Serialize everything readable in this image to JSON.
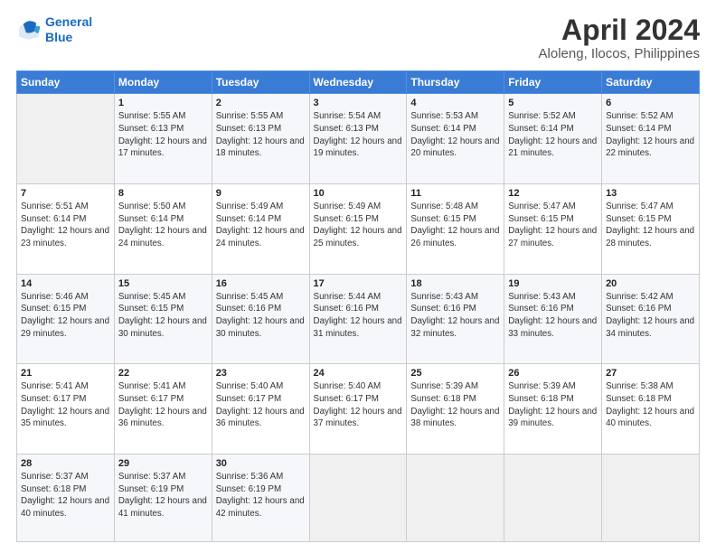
{
  "logo": {
    "line1": "General",
    "line2": "Blue"
  },
  "title": "April 2024",
  "subtitle": "Aloleng, Ilocos, Philippines",
  "days_header": [
    "Sunday",
    "Monday",
    "Tuesday",
    "Wednesday",
    "Thursday",
    "Friday",
    "Saturday"
  ],
  "weeks": [
    [
      {
        "num": "",
        "sunrise": "",
        "sunset": "",
        "daylight": ""
      },
      {
        "num": "1",
        "sunrise": "Sunrise: 5:55 AM",
        "sunset": "Sunset: 6:13 PM",
        "daylight": "Daylight: 12 hours and 17 minutes."
      },
      {
        "num": "2",
        "sunrise": "Sunrise: 5:55 AM",
        "sunset": "Sunset: 6:13 PM",
        "daylight": "Daylight: 12 hours and 18 minutes."
      },
      {
        "num": "3",
        "sunrise": "Sunrise: 5:54 AM",
        "sunset": "Sunset: 6:13 PM",
        "daylight": "Daylight: 12 hours and 19 minutes."
      },
      {
        "num": "4",
        "sunrise": "Sunrise: 5:53 AM",
        "sunset": "Sunset: 6:14 PM",
        "daylight": "Daylight: 12 hours and 20 minutes."
      },
      {
        "num": "5",
        "sunrise": "Sunrise: 5:52 AM",
        "sunset": "Sunset: 6:14 PM",
        "daylight": "Daylight: 12 hours and 21 minutes."
      },
      {
        "num": "6",
        "sunrise": "Sunrise: 5:52 AM",
        "sunset": "Sunset: 6:14 PM",
        "daylight": "Daylight: 12 hours and 22 minutes."
      }
    ],
    [
      {
        "num": "7",
        "sunrise": "Sunrise: 5:51 AM",
        "sunset": "Sunset: 6:14 PM",
        "daylight": "Daylight: 12 hours and 23 minutes."
      },
      {
        "num": "8",
        "sunrise": "Sunrise: 5:50 AM",
        "sunset": "Sunset: 6:14 PM",
        "daylight": "Daylight: 12 hours and 24 minutes."
      },
      {
        "num": "9",
        "sunrise": "Sunrise: 5:49 AM",
        "sunset": "Sunset: 6:14 PM",
        "daylight": "Daylight: 12 hours and 24 minutes."
      },
      {
        "num": "10",
        "sunrise": "Sunrise: 5:49 AM",
        "sunset": "Sunset: 6:15 PM",
        "daylight": "Daylight: 12 hours and 25 minutes."
      },
      {
        "num": "11",
        "sunrise": "Sunrise: 5:48 AM",
        "sunset": "Sunset: 6:15 PM",
        "daylight": "Daylight: 12 hours and 26 minutes."
      },
      {
        "num": "12",
        "sunrise": "Sunrise: 5:47 AM",
        "sunset": "Sunset: 6:15 PM",
        "daylight": "Daylight: 12 hours and 27 minutes."
      },
      {
        "num": "13",
        "sunrise": "Sunrise: 5:47 AM",
        "sunset": "Sunset: 6:15 PM",
        "daylight": "Daylight: 12 hours and 28 minutes."
      }
    ],
    [
      {
        "num": "14",
        "sunrise": "Sunrise: 5:46 AM",
        "sunset": "Sunset: 6:15 PM",
        "daylight": "Daylight: 12 hours and 29 minutes."
      },
      {
        "num": "15",
        "sunrise": "Sunrise: 5:45 AM",
        "sunset": "Sunset: 6:15 PM",
        "daylight": "Daylight: 12 hours and 30 minutes."
      },
      {
        "num": "16",
        "sunrise": "Sunrise: 5:45 AM",
        "sunset": "Sunset: 6:16 PM",
        "daylight": "Daylight: 12 hours and 30 minutes."
      },
      {
        "num": "17",
        "sunrise": "Sunrise: 5:44 AM",
        "sunset": "Sunset: 6:16 PM",
        "daylight": "Daylight: 12 hours and 31 minutes."
      },
      {
        "num": "18",
        "sunrise": "Sunrise: 5:43 AM",
        "sunset": "Sunset: 6:16 PM",
        "daylight": "Daylight: 12 hours and 32 minutes."
      },
      {
        "num": "19",
        "sunrise": "Sunrise: 5:43 AM",
        "sunset": "Sunset: 6:16 PM",
        "daylight": "Daylight: 12 hours and 33 minutes."
      },
      {
        "num": "20",
        "sunrise": "Sunrise: 5:42 AM",
        "sunset": "Sunset: 6:16 PM",
        "daylight": "Daylight: 12 hours and 34 minutes."
      }
    ],
    [
      {
        "num": "21",
        "sunrise": "Sunrise: 5:41 AM",
        "sunset": "Sunset: 6:17 PM",
        "daylight": "Daylight: 12 hours and 35 minutes."
      },
      {
        "num": "22",
        "sunrise": "Sunrise: 5:41 AM",
        "sunset": "Sunset: 6:17 PM",
        "daylight": "Daylight: 12 hours and 36 minutes."
      },
      {
        "num": "23",
        "sunrise": "Sunrise: 5:40 AM",
        "sunset": "Sunset: 6:17 PM",
        "daylight": "Daylight: 12 hours and 36 minutes."
      },
      {
        "num": "24",
        "sunrise": "Sunrise: 5:40 AM",
        "sunset": "Sunset: 6:17 PM",
        "daylight": "Daylight: 12 hours and 37 minutes."
      },
      {
        "num": "25",
        "sunrise": "Sunrise: 5:39 AM",
        "sunset": "Sunset: 6:18 PM",
        "daylight": "Daylight: 12 hours and 38 minutes."
      },
      {
        "num": "26",
        "sunrise": "Sunrise: 5:39 AM",
        "sunset": "Sunset: 6:18 PM",
        "daylight": "Daylight: 12 hours and 39 minutes."
      },
      {
        "num": "27",
        "sunrise": "Sunrise: 5:38 AM",
        "sunset": "Sunset: 6:18 PM",
        "daylight": "Daylight: 12 hours and 40 minutes."
      }
    ],
    [
      {
        "num": "28",
        "sunrise": "Sunrise: 5:37 AM",
        "sunset": "Sunset: 6:18 PM",
        "daylight": "Daylight: 12 hours and 40 minutes."
      },
      {
        "num": "29",
        "sunrise": "Sunrise: 5:37 AM",
        "sunset": "Sunset: 6:19 PM",
        "daylight": "Daylight: 12 hours and 41 minutes."
      },
      {
        "num": "30",
        "sunrise": "Sunrise: 5:36 AM",
        "sunset": "Sunset: 6:19 PM",
        "daylight": "Daylight: 12 hours and 42 minutes."
      },
      {
        "num": "",
        "sunrise": "",
        "sunset": "",
        "daylight": ""
      },
      {
        "num": "",
        "sunrise": "",
        "sunset": "",
        "daylight": ""
      },
      {
        "num": "",
        "sunrise": "",
        "sunset": "",
        "daylight": ""
      },
      {
        "num": "",
        "sunrise": "",
        "sunset": "",
        "daylight": ""
      }
    ]
  ]
}
